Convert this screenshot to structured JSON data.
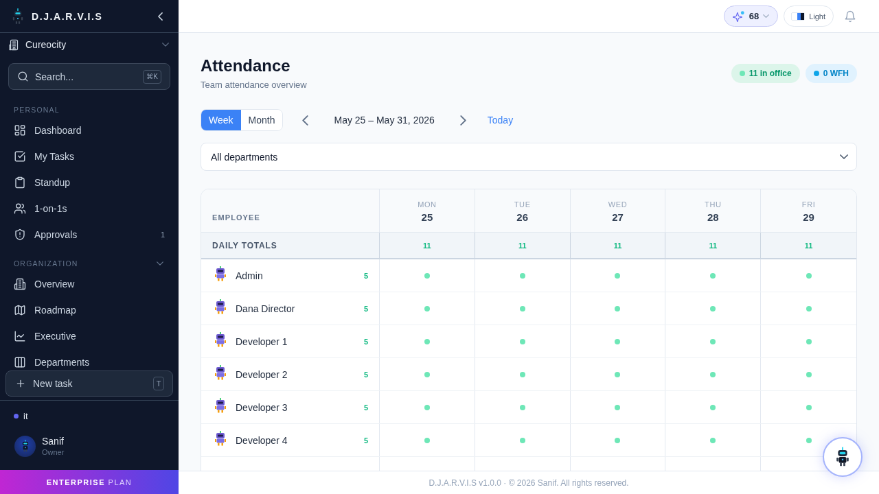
{
  "sidebar": {
    "brand": "D.J.A.R.V.I.S",
    "workspace": "Cureocity",
    "search": {
      "placeholder": "Search...",
      "shortcut": "⌘K"
    },
    "sections": [
      {
        "title": "PERSONAL",
        "items": [
          {
            "label": "Dashboard",
            "selected": false
          },
          {
            "label": "My Tasks",
            "selected": false
          },
          {
            "label": "Standup",
            "selected": false
          },
          {
            "label": "1-on-1s",
            "selected": false
          },
          {
            "label": "Approvals",
            "selected": false,
            "badge": "1"
          }
        ]
      },
      {
        "title": "ORGANIZATION",
        "expanded": true,
        "items": [
          {
            "label": "Overview",
            "selected": false
          },
          {
            "label": "Roadmap",
            "selected": false
          },
          {
            "label": "Executive",
            "selected": false
          },
          {
            "label": "Departments",
            "selected": false
          }
        ]
      }
    ],
    "new_task": {
      "label": "New task",
      "shortcut": "T"
    },
    "team": {
      "label": "it",
      "color": "#6366f1"
    },
    "user": {
      "name": "Sanif",
      "role": "Owner"
    },
    "plan": "**ENTERPRISE** PLAN"
  },
  "topbar": {
    "credits": "68",
    "theme": "Light"
  },
  "header": {
    "title": "Attendance",
    "subtitle": "Team attendance overview",
    "badges": [
      {
        "kind": "office",
        "label": "11 in office",
        "color": "#6ee7b7"
      },
      {
        "kind": "wfh",
        "label": "0 WFH",
        "color": "#0ea5e9"
      }
    ]
  },
  "controls": {
    "views": [
      {
        "label": "Week",
        "selected": true
      },
      {
        "label": "Month",
        "selected": false
      }
    ],
    "date_range": "May 25 – May 31, 2026",
    "today": "Today",
    "department": "All departments"
  },
  "table": {
    "employee_header": "EMPLOYEE",
    "days": [
      {
        "weekday": "MON",
        "date": "25"
      },
      {
        "weekday": "TUE",
        "date": "26"
      },
      {
        "weekday": "WED",
        "date": "27"
      },
      {
        "weekday": "THU",
        "date": "28"
      },
      {
        "weekday": "FRI",
        "date": "29"
      }
    ],
    "totals": {
      "label": "DAILY TOTALS",
      "values": [
        "11",
        "11",
        "11",
        "11",
        "11"
      ]
    },
    "rows": [
      {
        "name": "Admin",
        "count": "5",
        "days": [
          {
            "present": true
          },
          {
            "present": true
          },
          {
            "present": true
          },
          {
            "present": true
          },
          {
            "present": true
          }
        ]
      },
      {
        "name": "Dana Director",
        "count": "5",
        "days": [
          {
            "present": true
          },
          {
            "present": true
          },
          {
            "present": true
          },
          {
            "present": true
          },
          {
            "present": true
          }
        ]
      },
      {
        "name": "Developer 1",
        "count": "5",
        "days": [
          {
            "present": true
          },
          {
            "present": true
          },
          {
            "present": true
          },
          {
            "present": true
          },
          {
            "present": true
          }
        ]
      },
      {
        "name": "Developer 2",
        "count": "5",
        "days": [
          {
            "present": true
          },
          {
            "present": true
          },
          {
            "present": true
          },
          {
            "present": true
          },
          {
            "present": true
          }
        ]
      },
      {
        "name": "Developer 3",
        "count": "5",
        "days": [
          {
            "present": true
          },
          {
            "present": true
          },
          {
            "present": true
          },
          {
            "present": true
          },
          {
            "present": true
          }
        ]
      },
      {
        "name": "Developer 4",
        "count": "5",
        "days": [
          {
            "present": true
          },
          {
            "present": true
          },
          {
            "present": true
          },
          {
            "present": true
          },
          {
            "present": true
          }
        ]
      }
    ]
  },
  "footer": "D.J.A.R.V.I.S v1.0.0 · © 2026 Sanif. All rights reserved."
}
